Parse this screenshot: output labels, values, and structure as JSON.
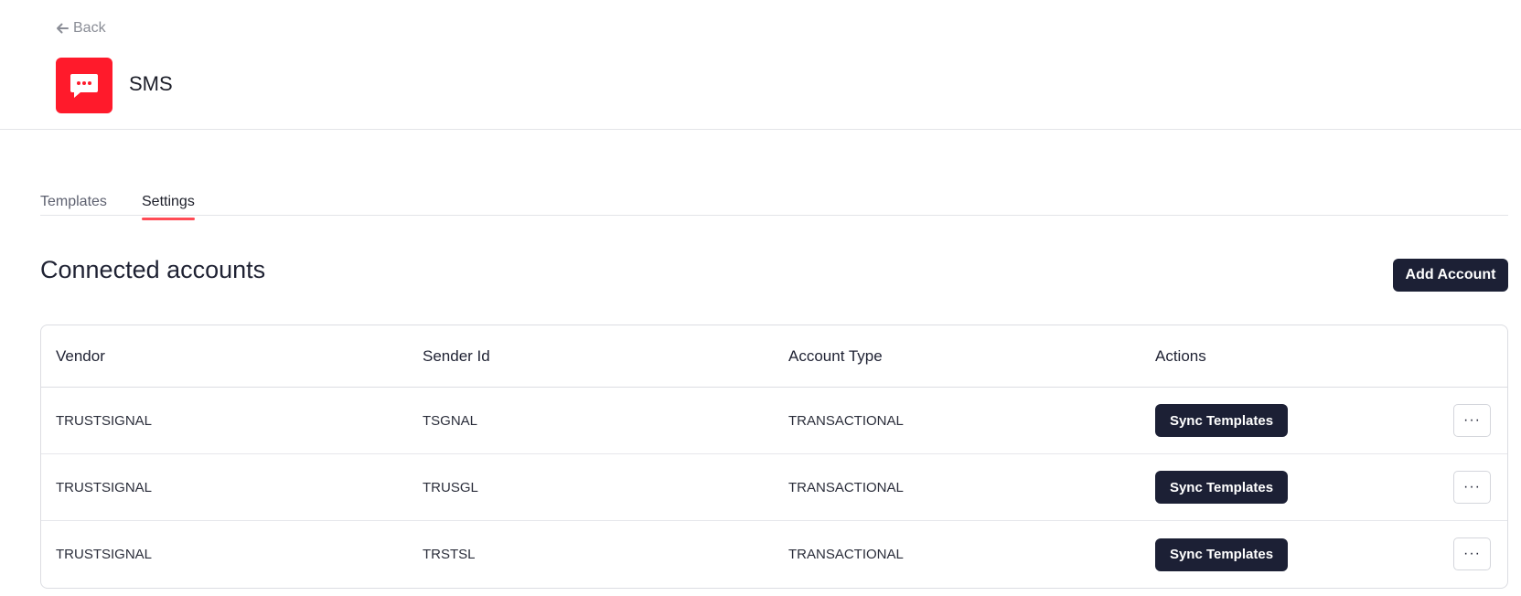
{
  "header": {
    "back_label": "Back",
    "app_icon": "sms-chat-bubble-icon",
    "app_title": "SMS",
    "brand_color": "#ff1a2b"
  },
  "tabs": [
    {
      "label": "Templates",
      "active": false
    },
    {
      "label": "Settings",
      "active": true
    }
  ],
  "section": {
    "title": "Connected accounts",
    "add_button_label": "Add Account"
  },
  "table": {
    "columns": [
      "Vendor",
      "Sender Id",
      "Account Type",
      "Actions"
    ],
    "rows": [
      {
        "vendor": "TRUSTSIGNAL",
        "sender_id": "TSGNAL",
        "account_type": "TRANSACTIONAL",
        "action_label": "Sync Templates",
        "more_label": "···"
      },
      {
        "vendor": "TRUSTSIGNAL",
        "sender_id": "TRUSGL",
        "account_type": "TRANSACTIONAL",
        "action_label": "Sync Templates",
        "more_label": "···"
      },
      {
        "vendor": "TRUSTSIGNAL",
        "sender_id": "TRSTSL",
        "account_type": "TRANSACTIONAL",
        "action_label": "Sync Templates",
        "more_label": "···"
      }
    ]
  },
  "colors": {
    "tab_underline": "#ff4b55",
    "button_dark": "#1c2035"
  }
}
